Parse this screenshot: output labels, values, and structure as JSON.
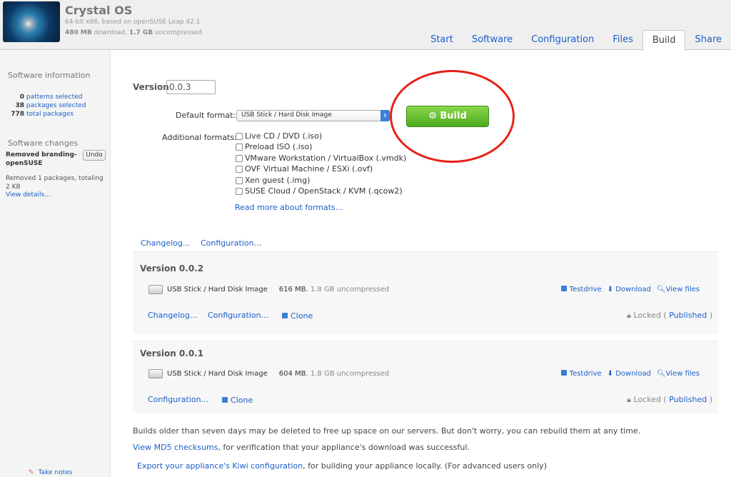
{
  "header": {
    "title": "Crystal OS",
    "subtitle": "64-bit x86, based on openSUSE Leap 42.1",
    "download_size": "480 MB",
    "download_label": " download, ",
    "uncompressed_size": "1.7 GB",
    "uncompressed_label": " uncompressed"
  },
  "tabs": [
    "Start",
    "Software",
    "Configuration",
    "Files",
    "Build",
    "Share"
  ],
  "sidebar": {
    "info_title": "Software information",
    "stats": [
      {
        "n": "0",
        "label": "patterns selected"
      },
      {
        "n": "38",
        "label": "packages selected"
      },
      {
        "n": "778",
        "label": "total packages"
      }
    ],
    "changes_title": "Software changes",
    "change_name": "Removed branding-openSUSE",
    "undo": "Undo",
    "change_desc": "Removed 1 packages, totaling 2 KB",
    "view_details": "View details...",
    "take_notes": "Take notes"
  },
  "build": {
    "version_label": "Version",
    "version": "0.0.3",
    "default_format_label": "Default format:",
    "default_format": "USB Stick / Hard Disk Image",
    "build_button": "Build",
    "additional_label": "Additional formats:",
    "formats": [
      "Live CD / DVD (.iso)",
      "Preload ISO (.iso)",
      "VMware Workstation / VirtualBox (.vmdk)",
      "OVF Virtual Machine / ESXi (.ovf)",
      "Xen guest (.img)",
      "SUSE Cloud / OpenStack / KVM (.qcow2)"
    ],
    "read_more": "Read more about formats..."
  },
  "top_links": [
    "Changelog...",
    "Configuration..."
  ],
  "versions": [
    {
      "title": "Version 0.0.2",
      "image": "USB Stick / Hard Disk Image",
      "size": "616 MB",
      "uncompressed": ", 1.8 GB uncompressed",
      "links": [
        "Changelog...",
        "Configuration..."
      ],
      "clone": "Clone"
    },
    {
      "title": "Version 0.0.1",
      "image": "USB Stick / Hard Disk Image",
      "size": "604 MB",
      "uncompressed": ", 1.8 GB uncompressed",
      "links": [
        "Configuration..."
      ],
      "clone": "Clone"
    }
  ],
  "actions": {
    "testdrive": "Testdrive",
    "download": "Download",
    "view_files": "View files",
    "locked": "Locked",
    "published": "Published"
  },
  "footer": {
    "note": "Builds older than seven days may be deleted to free up space on our servers. But don't worry, you can rebuild them at any time.",
    "md5_link": "View MD5 checksums",
    "md5_rest": ", for verification that your appliance's download was successful.",
    "kiwi_link": "Export your appliance's Kiwi configuration",
    "kiwi_rest": ", for building your appliance locally. (For advanced users only)"
  }
}
